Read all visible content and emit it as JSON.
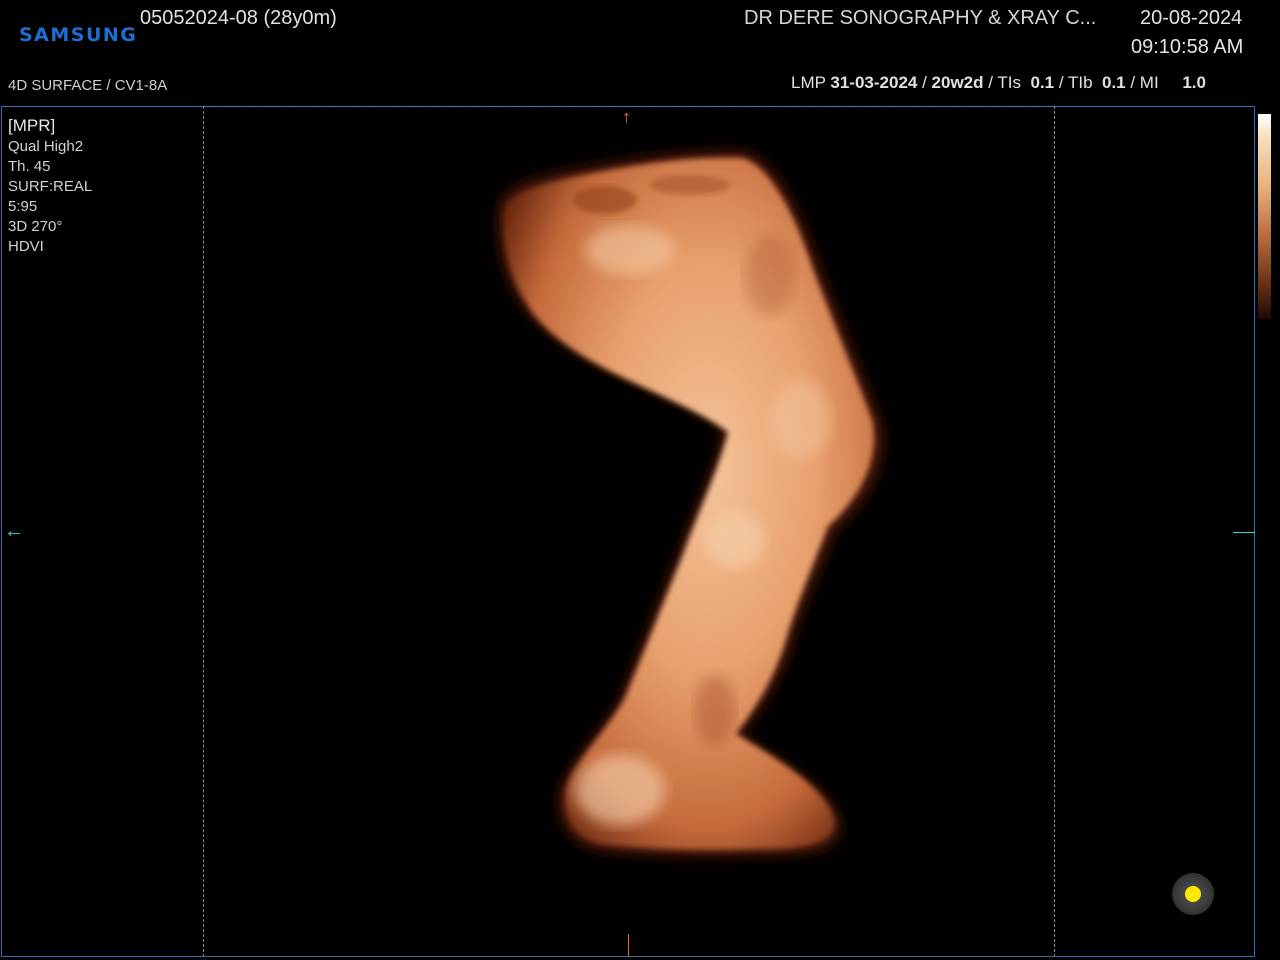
{
  "header": {
    "brand": "SAMSUNG",
    "patient_id": "05052024-08 (28y0m)",
    "institution": "DR DERE SONOGRAPHY & XRAY C...",
    "date": "20-08-2024",
    "time": "09:10:58 AM"
  },
  "subheader": {
    "mode": "4D SURFACE / CV1-8A",
    "lmp_label": "LMP",
    "lmp_date": "31-03-2024",
    "ga": "20w2d",
    "tis_label": "TIs",
    "tis_value": "0.1",
    "tib_label": "TIb",
    "tib_value": "0.1",
    "mi_label": "MI",
    "mi_value": "1.0"
  },
  "render_info": {
    "title": "[MPR]",
    "lines": [
      "Qual High2",
      "Th. 45",
      "SURF:REAL",
      "5:95",
      "3D 270°",
      "HDVI"
    ]
  },
  "colors": {
    "brand": "#1d6fd1",
    "frame": "#2f6fb7",
    "orientation_vertical": "#f06a30",
    "orientation_horizontal": "#37d6d6",
    "indicator": "#ffe800",
    "skin": "#e9a06f"
  },
  "icons": {
    "top_marker": "arrow-up-icon",
    "left_marker": "arrow-left-icon",
    "status_indicator": "yellow-dot-icon"
  }
}
